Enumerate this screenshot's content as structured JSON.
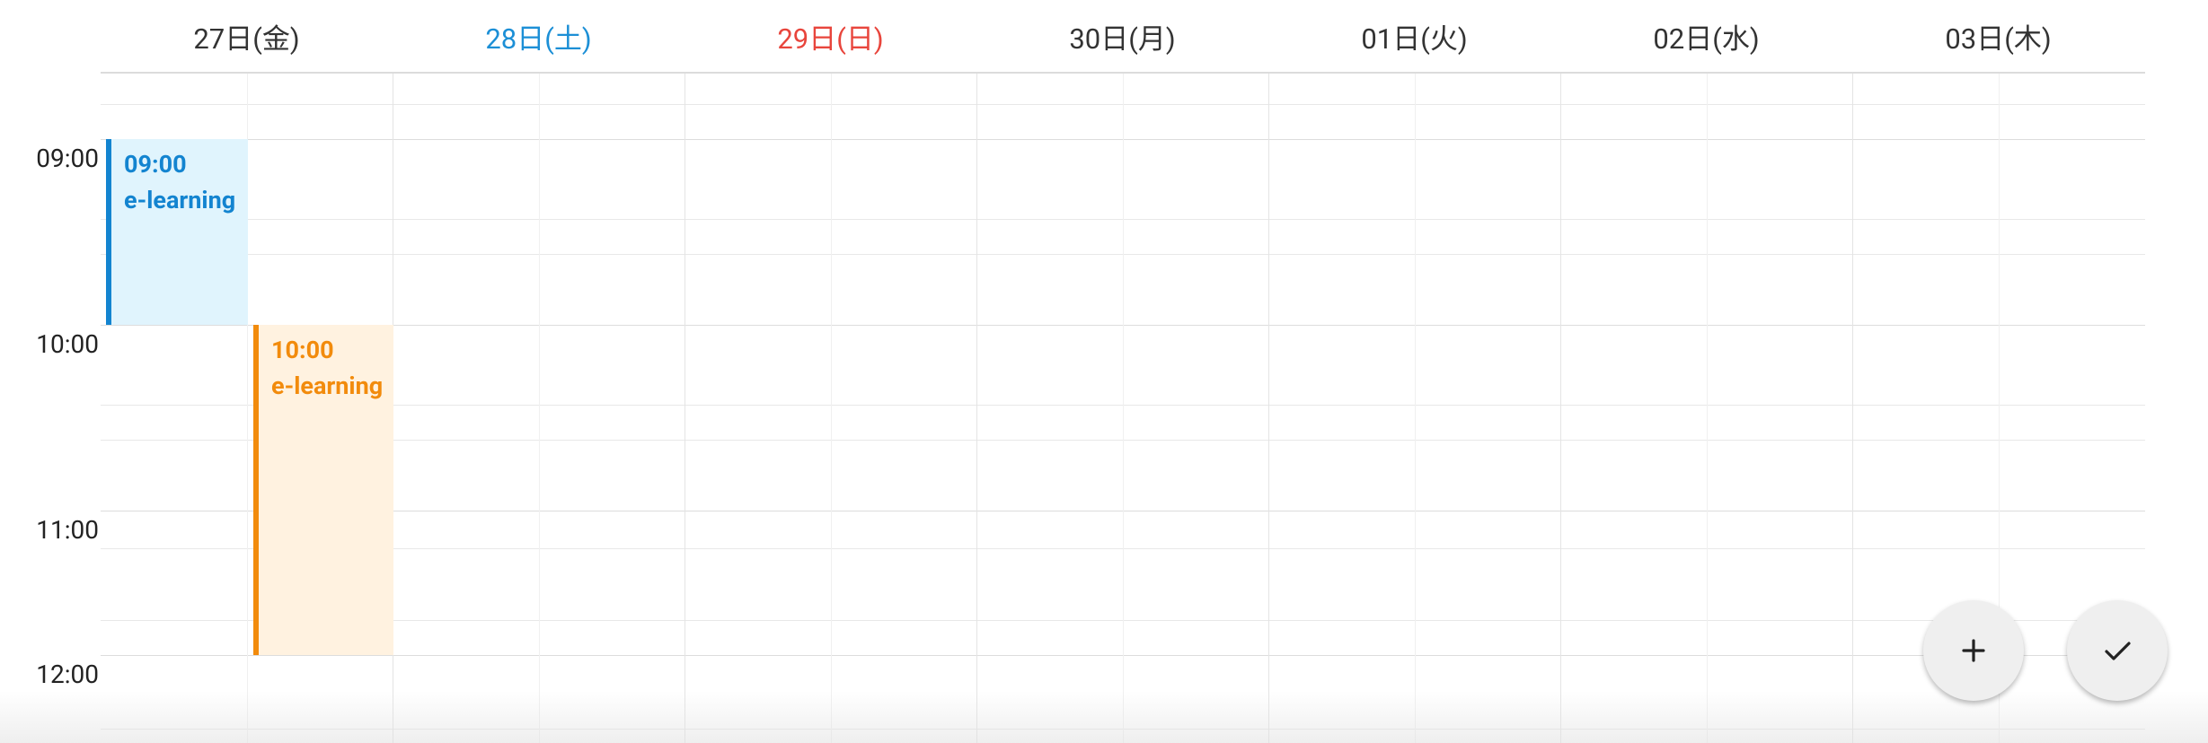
{
  "days": [
    {
      "label": "27日(金)",
      "kind": "weekday"
    },
    {
      "label": "28日(土)",
      "kind": "sat"
    },
    {
      "label": "29日(日)",
      "kind": "sun"
    },
    {
      "label": "30日(月)",
      "kind": "weekday"
    },
    {
      "label": "01日(火)",
      "kind": "weekday"
    },
    {
      "label": "02日(水)",
      "kind": "weekday"
    },
    {
      "label": "03日(木)",
      "kind": "weekday"
    }
  ],
  "times": [
    "09:00",
    "10:00",
    "11:00",
    "12:00"
  ],
  "events": [
    {
      "time": "09:00",
      "title": "e-learning",
      "color": "#1384d0"
    },
    {
      "time": "10:00",
      "title": "e-learning",
      "color": "#f28b0c"
    }
  ],
  "actions": {
    "add_icon": "plus-icon",
    "confirm_icon": "check-icon"
  },
  "colors": {
    "saturday": "#1c8fd6",
    "sunday": "#e8453c",
    "event_blue": "#1384d0",
    "event_orange": "#f28b0c"
  }
}
